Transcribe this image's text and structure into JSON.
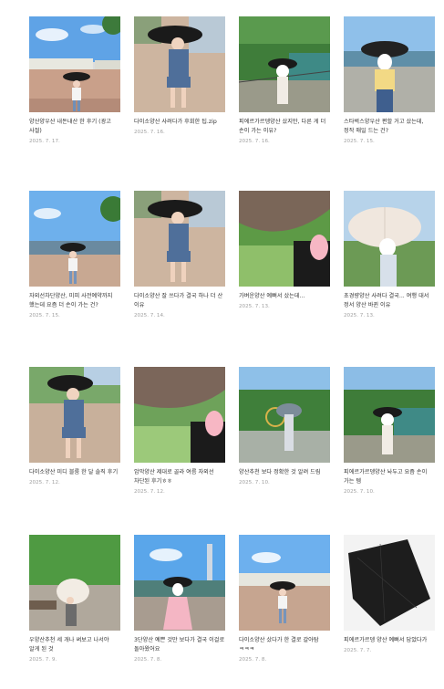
{
  "posts": [
    {
      "title": "양산양우산 내돈내산 한 후기 (광고 사절)",
      "date": "2025. 7. 17."
    },
    {
      "title": "다이소양산 사려다가 후회한 팁.zip",
      "date": "2025. 7. 16."
    },
    {
      "title": "피에르가르뎅양산 샀지만, 다른 게 더 손이 가는 이유?",
      "date": "2025. 7. 16."
    },
    {
      "title": "스타벅스양우산 편할 거고 샀는데, 정작 매일 드는 건?",
      "date": "2025. 7. 15."
    },
    {
      "title": "자외선차단양산, 미피 사전예약까지 했는데 요즘 더 손이 가는 건?",
      "date": "2025. 7. 15."
    },
    {
      "title": "다이소양산 잘 쓰다가 결국 하나 더 산 이유",
      "date": "2025. 7. 14."
    },
    {
      "title": "가벼운양산 예뻐서 샀는데...",
      "date": "2025. 7. 13."
    },
    {
      "title": "초경량양산 사려다 결국... 여행 대서 정서 양산 바뀐 이유",
      "date": "2025. 7. 13."
    },
    {
      "title": "다이소양산 미디 블룸 한 달 솔직 후기",
      "date": "2025. 7. 12."
    },
    {
      "title": "암막양산 제대로 골라 여름 자외선 차단된 후기ㅎㅎ",
      "date": "2025. 7. 12."
    },
    {
      "title": "양산추천 보다 정확한 것 알려 드림",
      "date": "2025. 7. 10."
    },
    {
      "title": "피에르가르뎅양산 놔두고 요즘 손이 가는 템",
      "date": "2025. 7. 10."
    },
    {
      "title": "우양산추천 세 개나 써보고 나서야 알게 된 것",
      "date": "2025. 7. 9."
    },
    {
      "title": "3단양산 예쁜 것만 보다가 결국 이걸로 돌아왔어요",
      "date": "2025. 7. 8."
    },
    {
      "title": "다이소양산 샀다가 한 결로 갈아탐 ㅋㅋㅋ",
      "date": "2025. 7. 8."
    },
    {
      "title": "피에르가르뎅 양산 예뻐서 담았다가",
      "date": "2025. 7. 7."
    }
  ]
}
